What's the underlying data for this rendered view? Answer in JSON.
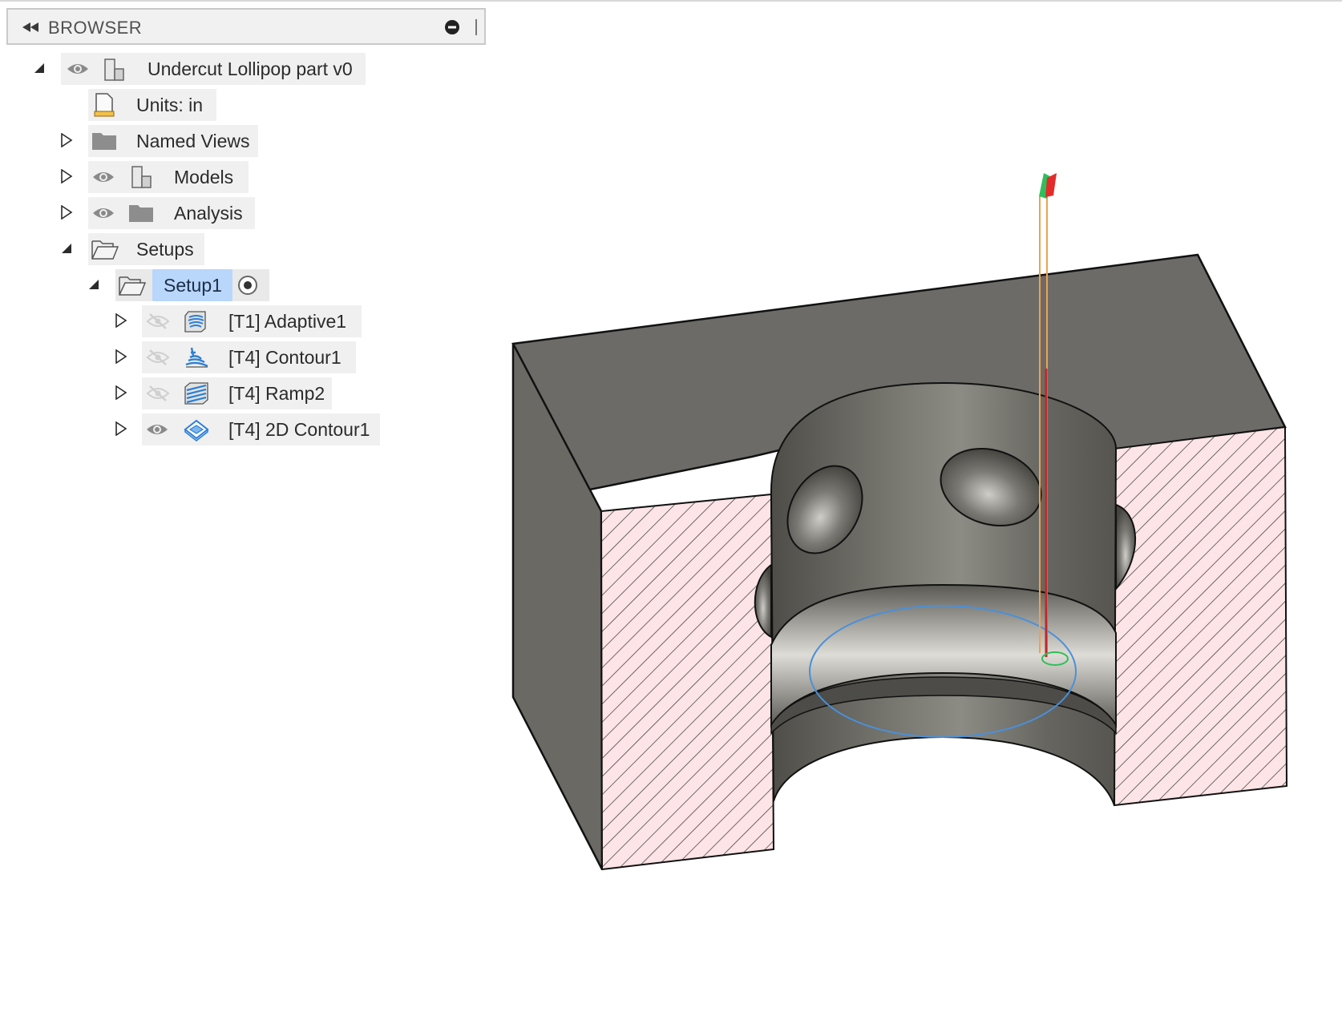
{
  "browser": {
    "title": "BROWSER",
    "root": {
      "label": "Undercut Lollipop part v0"
    },
    "units": {
      "label": "Units: in"
    },
    "named_views": {
      "label": "Named Views"
    },
    "models": {
      "label": "Models"
    },
    "analysis": {
      "label": "Analysis"
    },
    "setups": {
      "label": "Setups"
    },
    "setup1": {
      "label": "Setup1"
    },
    "operations": [
      {
        "label": "[T1] Adaptive1",
        "visible": false,
        "icon": "adaptive-toolpath-icon"
      },
      {
        "label": "[T4] Contour1",
        "visible": false,
        "icon": "contour-toolpath-icon"
      },
      {
        "label": "[T4] Ramp2",
        "visible": false,
        "icon": "ramp-toolpath-icon"
      },
      {
        "label": "[T4] 2D Contour1",
        "visible": true,
        "icon": "2d-contour-toolpath-icon"
      }
    ]
  },
  "colors": {
    "selected": "#b9d6fb",
    "part_body": "#6f6e69",
    "section_fill": "#fde4e6",
    "toolpath_blue": "#4a90d9",
    "tool_orange": "#f0a050"
  }
}
